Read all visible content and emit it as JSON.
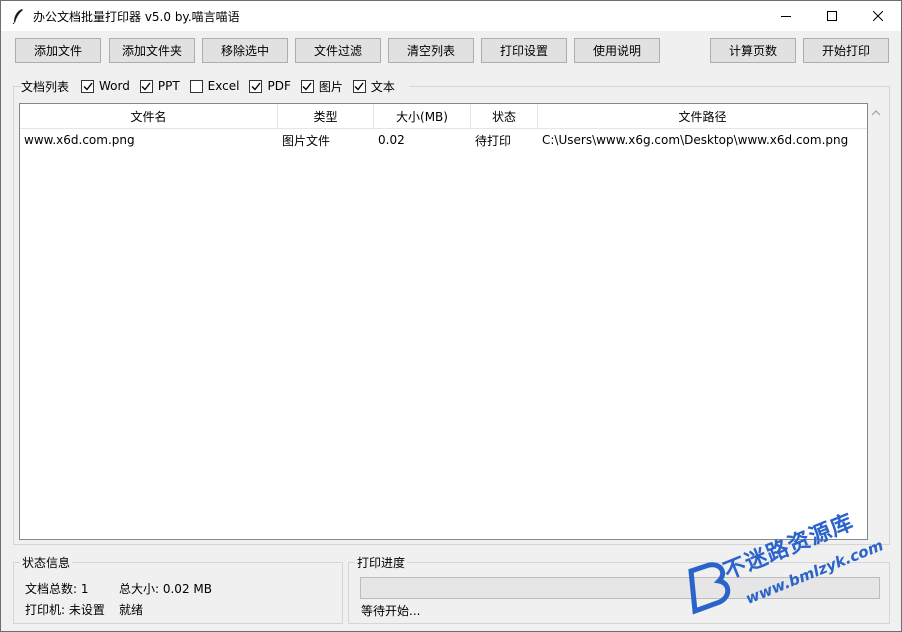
{
  "window": {
    "title": "办公文档批量打印器 v5.0 by.喵言喵语"
  },
  "toolbar": {
    "add_file": "添加文件",
    "add_folder": "添加文件夹",
    "remove_selected": "移除选中",
    "file_filter": "文件过滤",
    "clear_list": "清空列表",
    "print_settings": "打印设置",
    "usage_help": "使用说明",
    "count_pages": "计算页数",
    "start_print": "开始打印"
  },
  "filters": {
    "label": "文档列表",
    "items": [
      {
        "label": "Word",
        "checked": true
      },
      {
        "label": "PPT",
        "checked": true
      },
      {
        "label": "Excel",
        "checked": false
      },
      {
        "label": "PDF",
        "checked": true
      },
      {
        "label": "图片",
        "checked": true
      },
      {
        "label": "文本",
        "checked": true
      }
    ]
  },
  "table": {
    "columns": [
      "文件名",
      "类型",
      "大小(MB)",
      "状态",
      "文件路径"
    ],
    "rows": [
      {
        "name": "www.x6d.com.png",
        "type": "图片文件",
        "size": "0.02",
        "status": "待打印",
        "path": "C:\\Users\\www.x6g.com\\Desktop\\www.x6d.com.png"
      }
    ]
  },
  "status_info": {
    "title": "状态信息",
    "doc_count": "文档总数: 1",
    "total_size": "总大小: 0.02 MB",
    "printer": "打印机: 未设置",
    "state": "就绪"
  },
  "print_progress": {
    "title": "打印进度",
    "progress": 0,
    "message": "等待开始..."
  },
  "watermark": {
    "cn": "不迷路资源库",
    "en": "www.bmlzyk.com"
  },
  "colors": {
    "accent": "#2a63c9",
    "button_bg": "#e1e1e1",
    "window_bg": "#f0f0f0"
  }
}
